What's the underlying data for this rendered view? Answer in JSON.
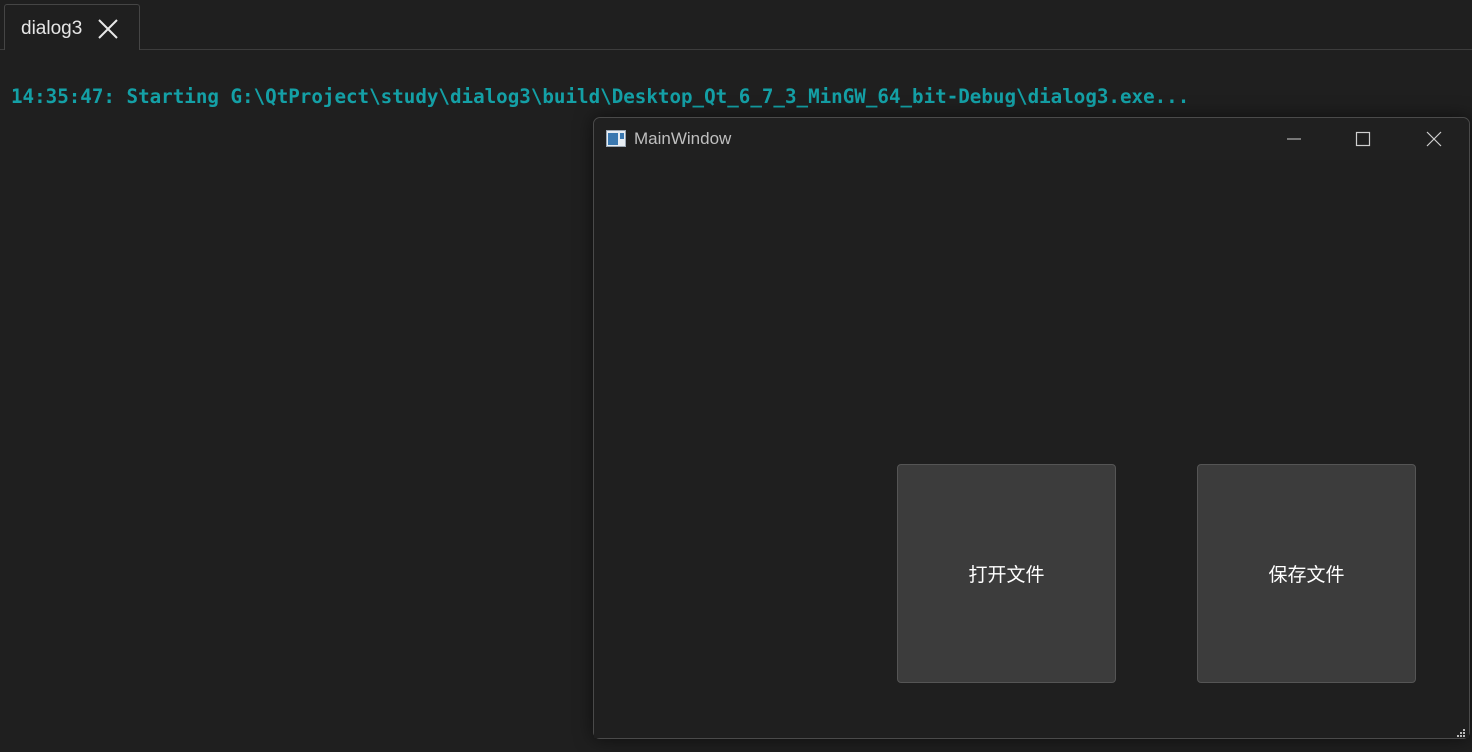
{
  "tab": {
    "label": "dialog3",
    "close_icon": "close-icon"
  },
  "output": {
    "log_line": "14:35:47: Starting G:\\QtProject\\study\\dialog3\\build\\Desktop_Qt_6_7_3_MinGW_64_bit-Debug\\dialog3.exe..."
  },
  "main_window": {
    "title": "MainWindow",
    "icon": "qt-app-icon",
    "controls": [
      "minimize-icon",
      "maximize-icon",
      "close-icon"
    ],
    "buttons": {
      "open_file": "打开文件",
      "save_file": "保存文件"
    }
  },
  "colors": {
    "background": "#1f1f1f",
    "log_text": "#14a0a6",
    "button_bg": "#3c3c3c"
  }
}
